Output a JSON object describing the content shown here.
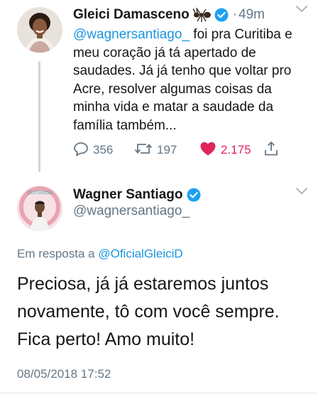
{
  "tweet1": {
    "author_name": "Gleici Damasceno",
    "ant_emoji": "ant-emoji",
    "separator": "·",
    "time": "49m",
    "mention": "@wagnersantiago_",
    "text_after_mention": " foi pra Curitiba e meu coração já tá apertado de saudades. Já já tenho que voltar pro Acre, resolver algumas coisas da minha vida e matar a saudade da família também...",
    "replies": "356",
    "retweets": "197",
    "likes": "2.175"
  },
  "tweet2": {
    "author_name": "Wagner Santiago",
    "handle": "@wagnersantiago_",
    "avatar_text": "QUITANDA",
    "reply_prefix": "Em resposta a",
    "reply_to": "@OficialGleiciD",
    "text": "Preciosa, já já estaremos juntos novamente, tô com você sempre. Fica perto! Amo muito!",
    "timestamp": "08/05/2018 17:52"
  },
  "colors": {
    "text": "#14171a",
    "secondary": "#657786",
    "link": "#1b95e0",
    "like": "#e0245e",
    "verified": "#1da1f2"
  }
}
